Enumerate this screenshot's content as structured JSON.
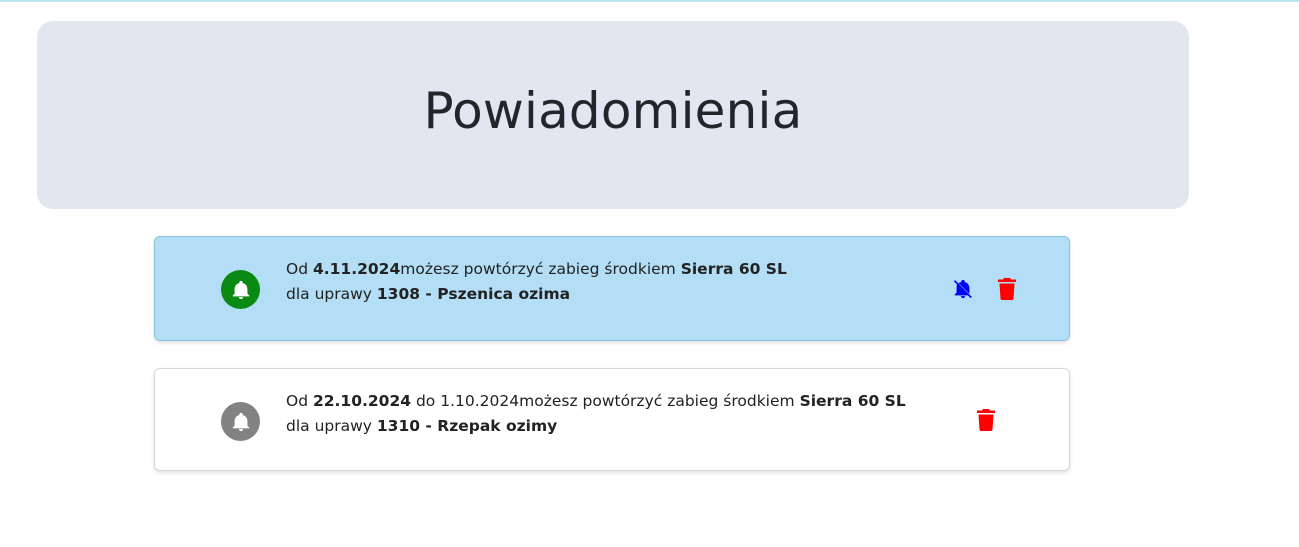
{
  "page": {
    "title": "Powiadomienia"
  },
  "notifications": [
    {
      "status": "active",
      "line1": {
        "prefix": "Od ",
        "date_from": "4.11.2024",
        "mid": "",
        "date_to": "",
        "text": "możesz powtórzyć zabieg środkiem ",
        "product": "Sierra 60 SL"
      },
      "line2": {
        "prefix": "dla uprawy ",
        "crop": "1308 - Pszenica ozima"
      },
      "icons": {
        "status": "bell-icon",
        "mute": "bell-slash-icon",
        "delete": "trash-icon"
      }
    },
    {
      "status": "inactive",
      "line1": {
        "prefix": "Od ",
        "date_from": "22.10.2024",
        "mid": " do ",
        "date_to": "1.10.2024",
        "text": "możesz powtórzyć zabieg środkiem ",
        "product": "Sierra 60 SL"
      },
      "line2": {
        "prefix": "dla uprawy ",
        "crop": "1310 - Rzepak ozimy"
      },
      "icons": {
        "status": "bell-icon",
        "delete": "trash-icon"
      }
    }
  ],
  "colors": {
    "active_bell_bg": "#0a8a12",
    "inactive_bell_bg": "#828282",
    "active_card_bg": "#b3def5",
    "mute_icon": "#0000ff",
    "delete_icon": "#ff0000"
  }
}
